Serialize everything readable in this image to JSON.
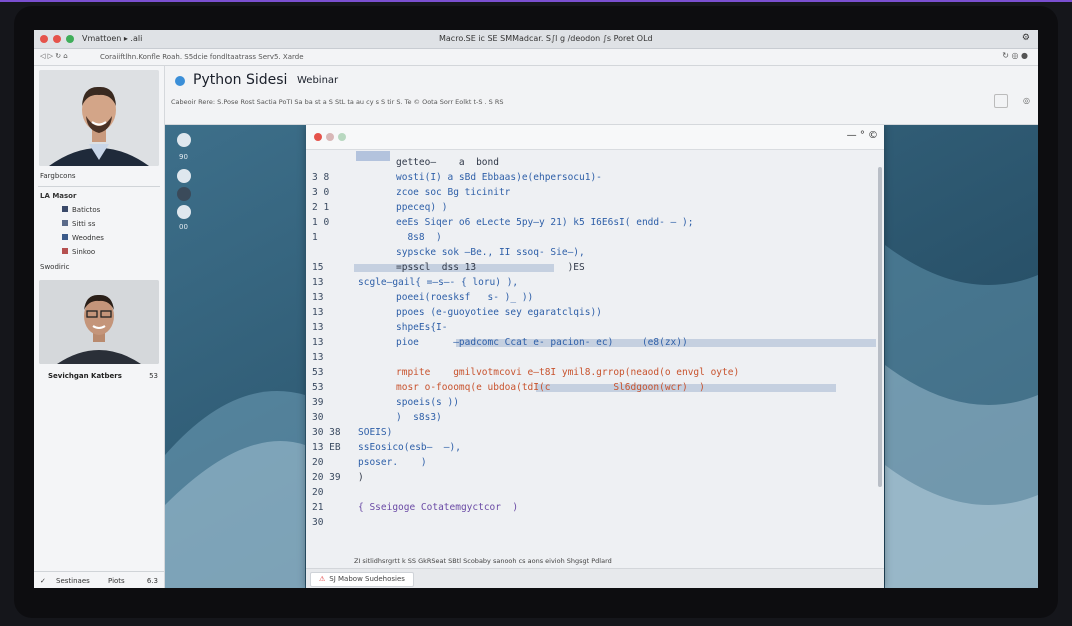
{
  "window": {
    "title": "Macro.SE ic SE SMMadcar. S∫l g /deodon ∫s   Poret OLd",
    "app_label": "Vmattoen ▸ .ali"
  },
  "url": {
    "text": "Coraiiftlhn.Konfle  Roah.  S5dcie fondltaatrass   Serv5.  Xarde"
  },
  "header": {
    "title": "Python Sidesi",
    "subtitle": "Webinar",
    "toolbar_text": "Cabeoir  Rere: S.Pose  Rost  Sactia  PoTI  Sa ba st a  S  StL  ta  au cy s  S  tir S. Te ©  Oota Sorr  Eolkt t-S .  S  RS"
  },
  "participants": {
    "section_label": "Fargbcons",
    "tree_header": "LA Masor",
    "tree_items": [
      "Batictos",
      "Sitti ss",
      "Weodnes",
      "Sinkoo"
    ],
    "tree_footer": "Swodiric",
    "presenter_name": "Sevichgan Katbers",
    "presenter_count": "53",
    "footer_left": "Sestinaes",
    "footer_mid": "Piots",
    "footer_right": "6.3"
  },
  "dock": {
    "labels": [
      "90",
      "00"
    ]
  },
  "editor": {
    "lines": [
      {
        "num": "",
        "num2": "",
        "text": "getteo—    a  bond",
        "color": "dark"
      },
      {
        "num": "3",
        "num2": "8",
        "text": "wosti(I) a sBd Ebbaas)e(ehpersocu1)-",
        "color": "blue"
      },
      {
        "num": "3",
        "num2": "0",
        "text": "zcoe soc Bg ticinitr",
        "color": "blue"
      },
      {
        "num": "2",
        "num2": "1",
        "text": "ppeceq) )",
        "color": "blue"
      },
      {
        "num": "1",
        "num2": "0",
        "text": "eeEs Siqer o6 eLecte 5py–y 21) k5 I6E6sI( endd- – );",
        "color": "blue"
      },
      {
        "num": "1",
        "num2": "",
        "text": "  8s8  )",
        "color": "blue"
      },
      {
        "num": "",
        "num2": "",
        "text": "sypscke sok –Be., II ssoq- Sie–),",
        "color": "blue"
      },
      {
        "num": "15",
        "num2": "",
        "text": "=psscl  dss 13                )ES",
        "color": "dark"
      },
      {
        "num": "13",
        "num2": "",
        "text": "scgle—gail{ =—s–- { loru) ),",
        "color": "blue"
      },
      {
        "num": "13",
        "num2": "",
        "text": "poeei(roesksf   s- )_ ))",
        "color": "blue"
      },
      {
        "num": "13",
        "num2": "",
        "text": "ppoes (e-guoyotiee sey egaratclqis))",
        "color": "blue"
      },
      {
        "num": "13",
        "num2": "",
        "text": "shpeEs{I-",
        "color": "blue"
      },
      {
        "num": "13",
        "num2": "",
        "text": "pioe      –padcomc Ccat e- pacion- ec)     (e8(zx))",
        "color": "blue"
      },
      {
        "num": "13",
        "num2": "",
        "text": "",
        "color": "blue"
      },
      {
        "num": "53",
        "num2": "",
        "text": "rmpite    gmilvotmcovi e–t8I ymil8.grrop(neaod(o envgl oyte)",
        "color": "orange"
      },
      {
        "num": "53",
        "num2": "",
        "text": "mosr o-fooomq(e ubdoa(tdI(c           Sl6dgoon(wcr)  )",
        "color": "orange"
      },
      {
        "num": "39",
        "num2": "",
        "text": "spoeis(s ))",
        "color": "blue"
      },
      {
        "num": "30",
        "num2": "",
        "text": ")  s8s3)",
        "color": "blue"
      },
      {
        "num": "30",
        "num2": "38",
        "text": "SOEIS)",
        "color": "blue"
      },
      {
        "num": "13",
        "num2": "EB",
        "text": "ssEosico(esb–  –),",
        "color": "blue"
      },
      {
        "num": "20",
        "num2": "",
        "text": "psoser.    )",
        "color": "blue"
      },
      {
        "num": "20",
        "num2": "39",
        "text": ")",
        "color": "dark"
      },
      {
        "num": "20",
        "num2": "",
        "text": "",
        "color": "dark"
      },
      {
        "num": "21",
        "num2": "",
        "text": "{ Sseigoge Cotatemgyctcor  )",
        "color": "purple"
      },
      {
        "num": "30",
        "num2": "",
        "text": "",
        "color": "dark"
      }
    ],
    "status_text": "ZI  sitlidhsrgrtt  k SS GkRSeat SBtl Scobaby sanooh cs aons  eivioh Shgsgt Pdlard",
    "tab_label": "SJ Mabow Sudehosies",
    "window_controls": "— ° ©"
  },
  "colors": {
    "accent": "#7a4fd0",
    "stage": "#2f5c75",
    "code_blue": "#2e5fa8",
    "code_orange": "#c8532e"
  },
  "icons": [
    "close-dot",
    "minimize-dot",
    "maximize-dot",
    "record-dot",
    "settings-icon",
    "refresh-icon",
    "lock-icon"
  ]
}
